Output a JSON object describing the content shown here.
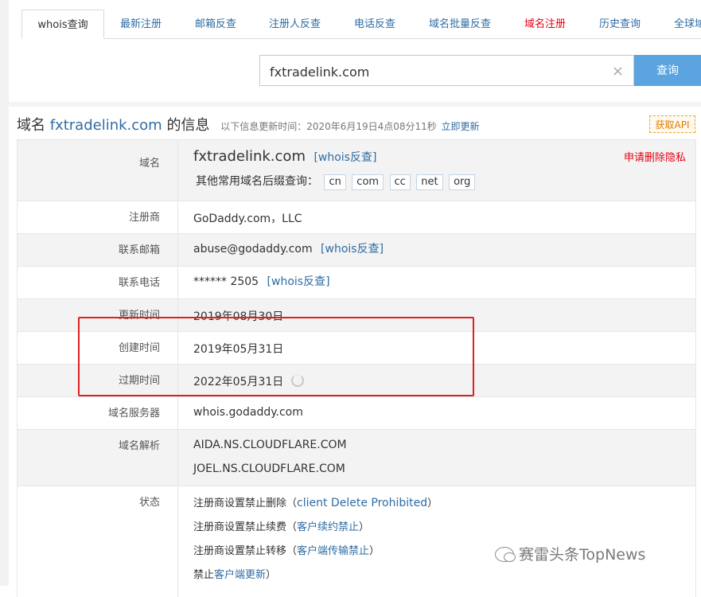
{
  "tabs": [
    {
      "label": "whois查询",
      "active": true
    },
    {
      "label": "最新注册"
    },
    {
      "label": "邮箱反查"
    },
    {
      "label": "注册人反查"
    },
    {
      "label": "电话反查"
    },
    {
      "label": "域名批量反查"
    },
    {
      "label": "域名注册",
      "color": "#e60012"
    },
    {
      "label": "历史查询"
    },
    {
      "label": "全球域"
    }
  ],
  "search": {
    "value": "fxtradelink.com",
    "button_label": "查询",
    "clear_icon": "×"
  },
  "heading": {
    "prefix": "域名",
    "domain": "fxtradelink.com",
    "suffix": "的信息",
    "updated": "以下信息更新时间：2020年6月19日4点08分11秒",
    "refresh": "立即更新",
    "api_label": "获取API"
  },
  "rows": {
    "domain": {
      "label": "域名",
      "value": "fxtradelink.com",
      "link": "[whois反查]",
      "suffix_prompt": "其他常用域名后缀查询：",
      "suffixes": [
        "cn",
        "com",
        "cc",
        "net",
        "org"
      ],
      "privacy_link": "申请删除隐私"
    },
    "registrar": {
      "label": "注册商",
      "value": "GoDaddy.com，LLC"
    },
    "email": {
      "label": "联系邮箱",
      "value": "abuse@godaddy.com",
      "link": "[whois反查]"
    },
    "phone": {
      "label": "联系电话",
      "value": "****** 2505",
      "link": "[whois反查]"
    },
    "updated": {
      "label": "更新时间",
      "value": "2019年08月30日"
    },
    "created": {
      "label": "创建时间",
      "value": "2019年05月31日"
    },
    "expires": {
      "label": "过期时间",
      "value": "2022年05月31日"
    },
    "server": {
      "label": "域名服务器",
      "value": "whois.godaddy.com"
    },
    "dns": {
      "label": "域名解析",
      "values": [
        "AIDA.NS.CLOUDFLARE.COM",
        "JOEL.NS.CLOUDFLARE.COM"
      ]
    },
    "status": {
      "label": "状态",
      "items": [
        {
          "text": "注册商设置禁止删除",
          "link": "client Delete Prohibited"
        },
        {
          "text": "注册商设置禁止续费",
          "link": "客户续约禁止"
        },
        {
          "text": "注册商设置禁止转移",
          "link": "客户端传输禁止"
        },
        {
          "text": "禁止",
          "link": "客户端更新"
        }
      ]
    }
  },
  "watermark": "赛雷头条TopNews"
}
